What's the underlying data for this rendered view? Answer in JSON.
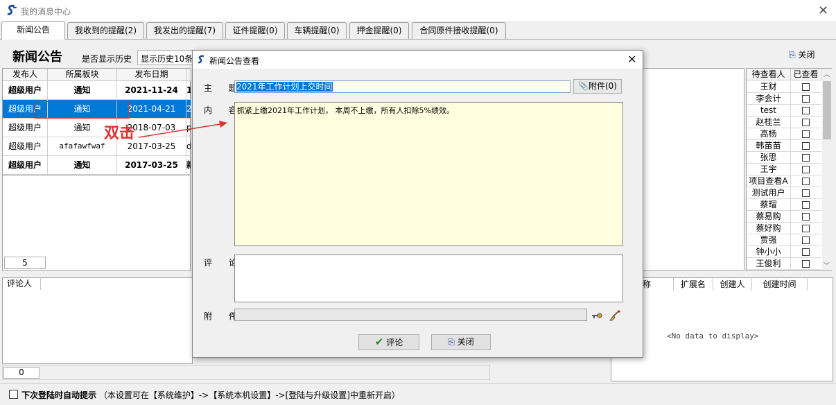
{
  "window": {
    "title": "我的消息中心"
  },
  "tabs": [
    {
      "label": "新闻公告"
    },
    {
      "label": "我收到的提醒(2)"
    },
    {
      "label": "我发出的提醒(7)"
    },
    {
      "label": "证件提醒(0)"
    },
    {
      "label": "车辆提醒(0)"
    },
    {
      "label": "押金提醒(0)"
    },
    {
      "label": "合同原件接收提醒(0)"
    }
  ],
  "header": {
    "title": "新闻公告",
    "history_label": "是否显示历史",
    "history_value": "显示历史10条",
    "close_label": "关闭"
  },
  "news_table": {
    "columns": [
      "发布人",
      "所属板块",
      "发布日期"
    ],
    "rows": [
      {
        "publisher": "超级用户",
        "section": "通知",
        "date": "2021-11-24",
        "extra": "1"
      },
      {
        "publisher": "超级用户",
        "section": "通知",
        "date": "2021-04-21",
        "extra": "2"
      },
      {
        "publisher": "超级用户",
        "section": "通知",
        "date": "2018-07-03",
        "extra": "p"
      },
      {
        "publisher": "超级用户",
        "section": "afafawfwaf",
        "date": "2017-03-25",
        "extra": "d"
      },
      {
        "publisher": "超级用户",
        "section": "通知",
        "date": "2017-03-25",
        "extra": "新"
      }
    ],
    "count": "5"
  },
  "comments": {
    "column": "评论人",
    "count": "0"
  },
  "viewers": {
    "columns": [
      "待查看人",
      "已查看"
    ],
    "names": [
      "王财",
      "李会计",
      "test",
      "赵桂兰",
      "高杨",
      "韩苗苗",
      "张思",
      "王宇",
      "项目查看A",
      "测试用户",
      "蔡瑁",
      "蔡易购",
      "蔡好购",
      "贾强",
      "钟小小",
      "王俊利"
    ]
  },
  "attachments": {
    "columns": [
      "称",
      "扩展名",
      "创建人",
      "创建时间"
    ],
    "empty_text": "<No data to display>"
  },
  "footer": {
    "auto_prompt": "下次登陆时自动提示",
    "note": "（本设置可在【系统维护】->【系统本机设置】->[登陆与升级设置]中重新开启）"
  },
  "dialog": {
    "title": "新闻公告查看",
    "subject_label": "主 题",
    "subject_value": "2021年工作计划上交时间",
    "attach_button": "附件(0)",
    "content_label": "内 容",
    "content_value": "抓紧上缴2021年工作计划， 本周不上缴，所有人扣除5%绩效。",
    "comment_label": "评 论",
    "attach_label": "附 件",
    "comment_button": "评论",
    "close_button": "关闭"
  },
  "annotation": {
    "text": "双击"
  },
  "colors": {
    "selection": "#0078d7",
    "annotation": "#e03030",
    "content_bg": "#ffffe0"
  }
}
